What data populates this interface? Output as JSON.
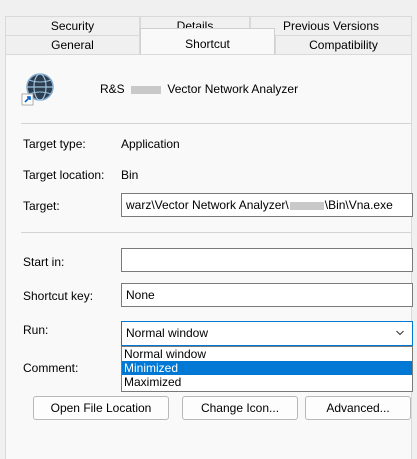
{
  "tabs": {
    "back": [
      "Security",
      "Details",
      "Previous Versions"
    ],
    "front": [
      "General",
      "Shortcut",
      "Compatibility"
    ]
  },
  "app": {
    "name_prefix": "R&S",
    "name_suffix": "Vector Network Analyzer",
    "icon": "vna-globe-shortcut-icon"
  },
  "info": {
    "target_type_label": "Target type:",
    "target_type_value": "Application",
    "target_location_label": "Target location:",
    "target_location_value": "Bin",
    "target_label": "Target:",
    "target_value_a": "warz\\Vector Network Analyzer\\",
    "target_value_b": "\\Bin\\Vna.exe"
  },
  "fields": {
    "start_in_label": "Start in:",
    "start_in_value": "",
    "shortcut_key_label": "Shortcut key:",
    "shortcut_key_value": "None",
    "run_label": "Run:",
    "run_value": "Normal window",
    "run_options": [
      "Normal window",
      "Minimized",
      "Maximized"
    ],
    "run_highlighted": "Minimized",
    "comment_label": "Comment:"
  },
  "buttons": {
    "open_location": "Open File Location",
    "change_icon": "Change Icon...",
    "advanced": "Advanced..."
  },
  "colors": {
    "accent": "#0078d4",
    "panel": "#f9f9f9",
    "window": "#f0f0f0"
  }
}
